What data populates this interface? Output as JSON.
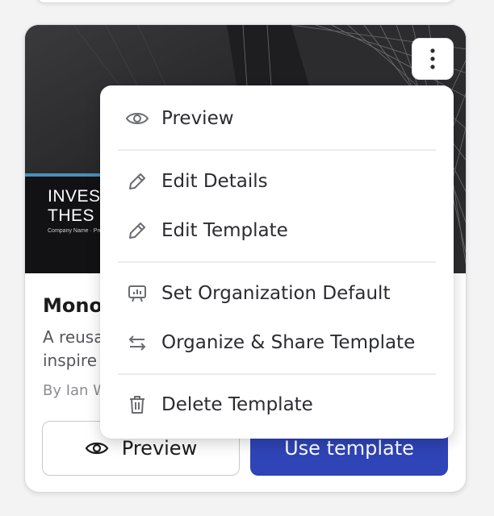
{
  "thumbnail": {
    "slide_title_line1": "INVES",
    "slide_title_line2": "THES",
    "slide_subtitle": "Company Name · Pre"
  },
  "card": {
    "title": "Mono",
    "description_line1": "A reusa",
    "description_line2": "inspire",
    "author": "By Ian W",
    "preview_label": "Preview",
    "use_label": "Use template"
  },
  "menu": {
    "items": [
      {
        "label": "Preview",
        "icon": "eye-icon"
      },
      {
        "label": "Edit Details",
        "icon": "pencil-icon"
      },
      {
        "label": "Edit Template",
        "icon": "pencil-icon"
      },
      {
        "label": "Set Organization Default",
        "icon": "presentation-icon"
      },
      {
        "label": "Organize & Share Template",
        "icon": "swap-arrows-icon"
      },
      {
        "label": "Delete Template",
        "icon": "trash-icon"
      }
    ]
  },
  "colors": {
    "primary_button": "#2f44b6",
    "accent_stripe": "#4a90b8"
  }
}
